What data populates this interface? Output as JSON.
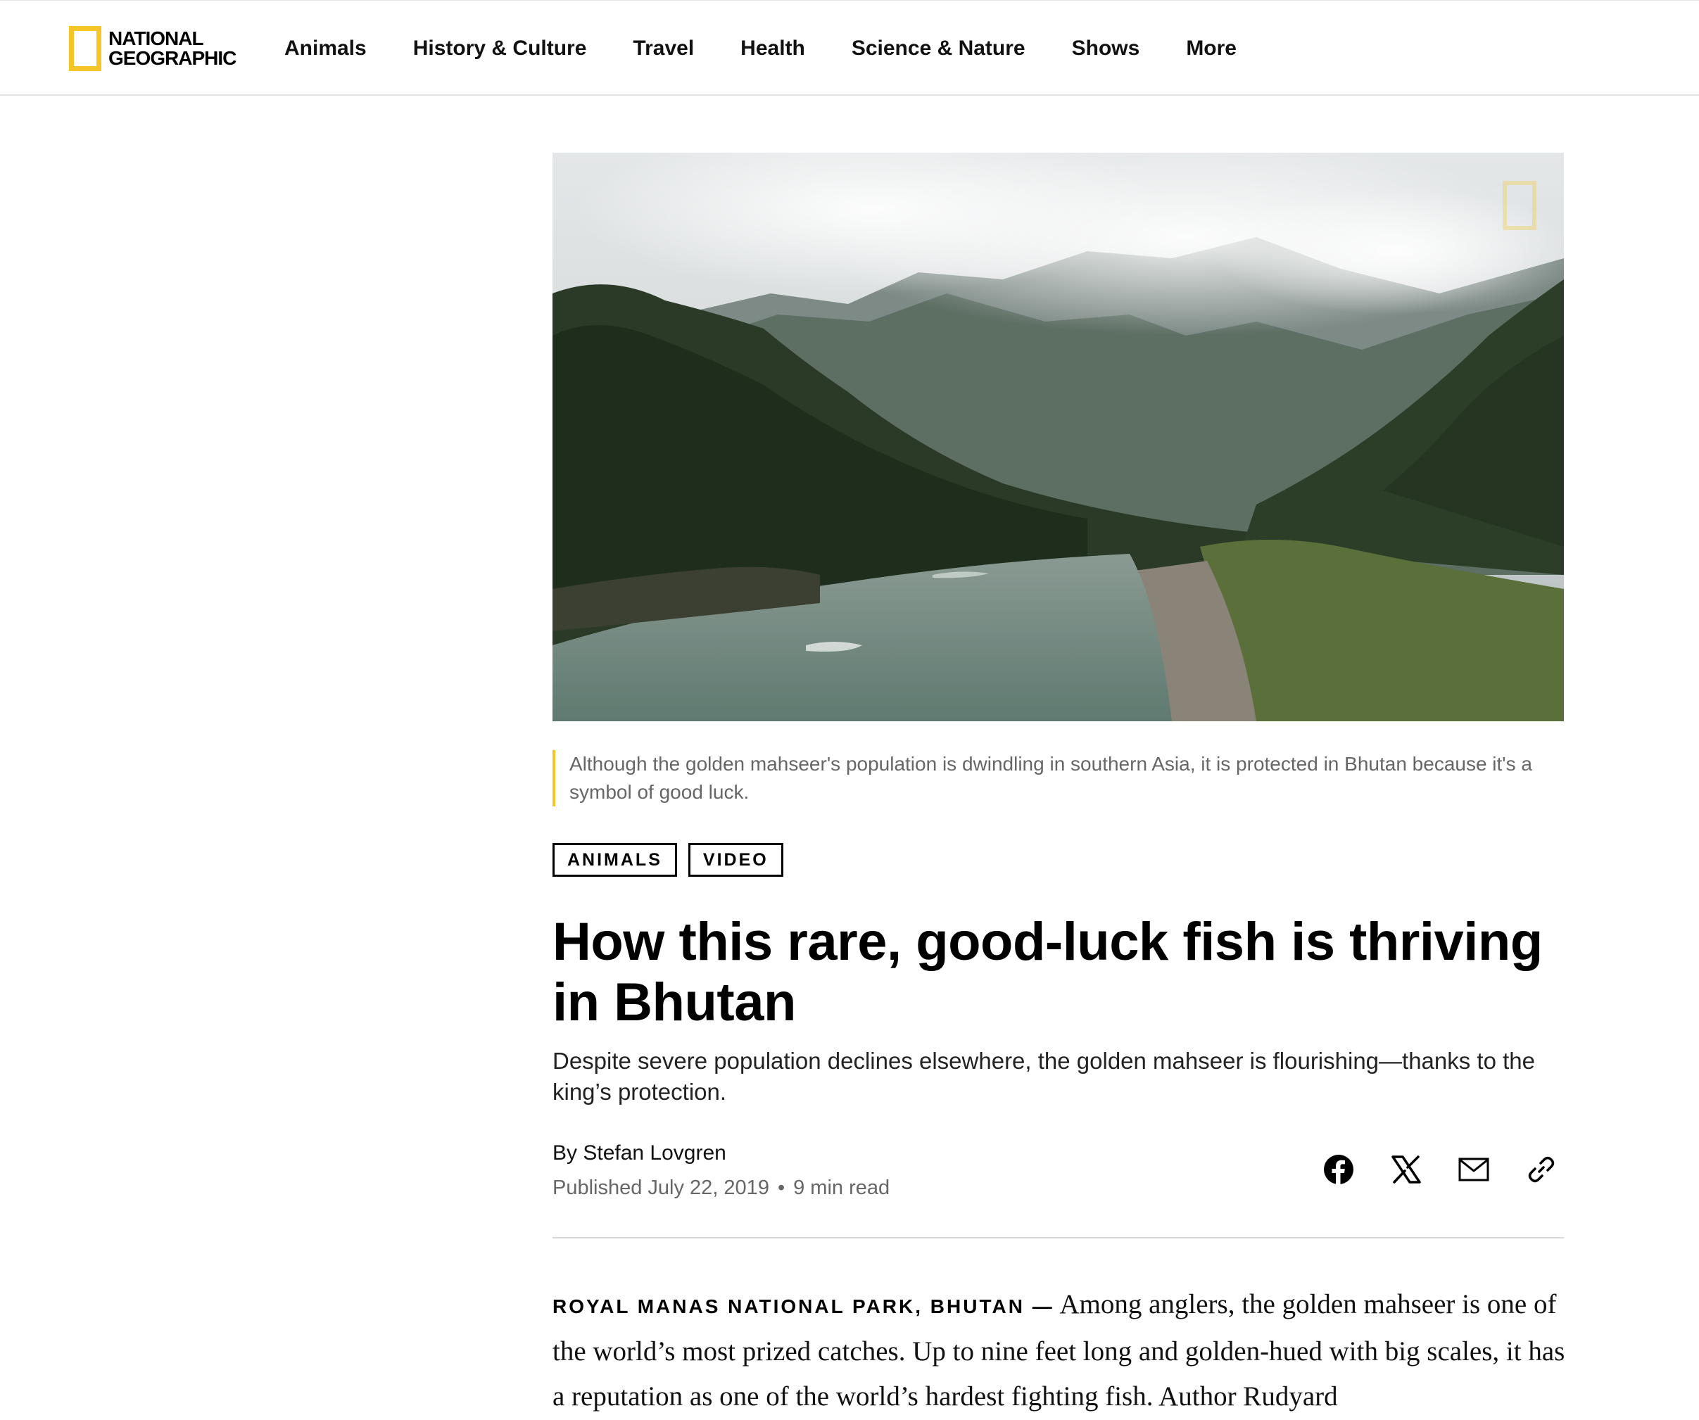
{
  "header": {
    "logo": {
      "line1": "NATIONAL",
      "line2": "GEOGRAPHIC",
      "color": "#f6c628"
    },
    "nav": [
      "Animals",
      "History & Culture",
      "Travel",
      "Health",
      "Science & Nature",
      "Shows",
      "More"
    ]
  },
  "hero": {
    "image_description": "river-valley-photo",
    "caption": "Although the golden mahseer's population is dwindling in southern Asia, it is protected in Bhutan because it's a symbol of good luck."
  },
  "tags": [
    "ANIMALS",
    "VIDEO"
  ],
  "article": {
    "headline": "How this rare, good-luck fish is thriving in Bhutan",
    "dek": "Despite severe population declines elsewhere, the golden mahseer is flourishing—thanks to the king’s protection.",
    "byline_prefix": "By",
    "author": "Stefan Lovgren",
    "published": "Published July 22, 2019",
    "read_time": "9 min read",
    "dateline": "ROYAL MANAS NATIONAL PARK, BHUTAN —",
    "body": "Among anglers, the golden mahseer is one of the world’s most prized catches. Up to nine feet long and golden-hued with big scales, it has a reputation as one of the world’s hardest fighting fish. Author Rudyard"
  },
  "share": {
    "icons": [
      "facebook-icon",
      "x-icon",
      "email-icon",
      "link-icon"
    ]
  }
}
